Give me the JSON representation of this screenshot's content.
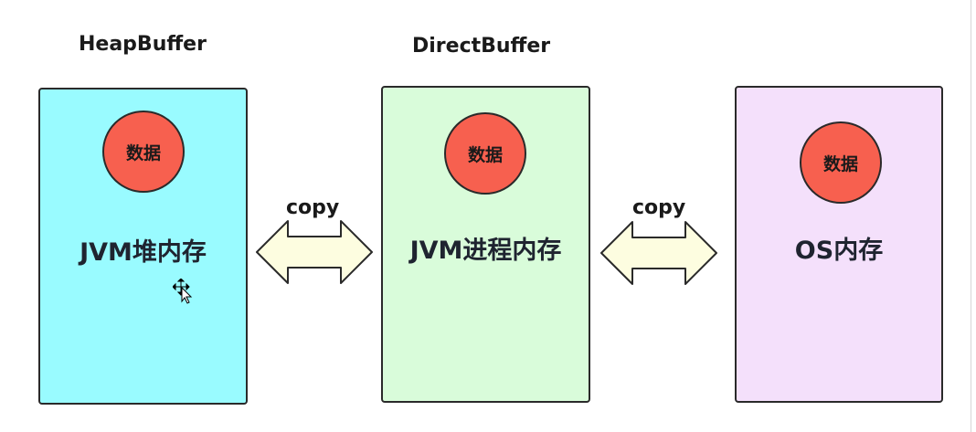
{
  "titles": {
    "heap": "HeapBuffer",
    "direct": "DirectBuffer"
  },
  "panels": {
    "heap": {
      "data_label": "数据",
      "memory_label": "JVM堆内存",
      "color": "#99fbff"
    },
    "direct": {
      "data_label": "数据",
      "memory_label": "JVM进程内存",
      "color": "#d9fcda"
    },
    "os": {
      "data_label": "数据",
      "memory_label": "OS内存",
      "color": "#f4e0fb"
    }
  },
  "arrows": {
    "left": {
      "label": "copy",
      "direction": "bidirectional"
    },
    "right": {
      "label": "copy",
      "direction": "bidirectional"
    },
    "fill_color": "#fdfde0"
  },
  "data_circle_color": "#f7604f",
  "cursor": {
    "icon": "move-cursor-icon"
  }
}
